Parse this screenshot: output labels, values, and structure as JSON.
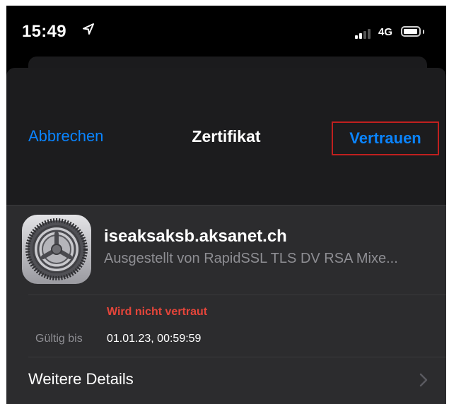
{
  "status_bar": {
    "time": "15:49",
    "location_icon": "location-arrow-icon",
    "signal_icon": "cellular-signal-icon",
    "network": "4G",
    "battery_icon": "battery-icon"
  },
  "nav": {
    "cancel_label": "Abbrechen",
    "title": "Zertifikat",
    "trust_label": "Vertrauen",
    "accent_color": "#0a84ff",
    "highlight_color": "#c0201f"
  },
  "certificate": {
    "icon": "settings-gear-icon",
    "name": "iseaksaksb.aksanet.ch",
    "issuer": "Ausgestellt von RapidSSL TLS DV RSA Mixe...",
    "trust_status": "Wird nicht vertraut",
    "trust_status_color": "#e5453a",
    "valid_label": "Gültig bis",
    "valid_value": "01.01.23, 00:59:59"
  },
  "details": {
    "label": "Weitere Details",
    "chevron_icon": "chevron-right-icon"
  }
}
